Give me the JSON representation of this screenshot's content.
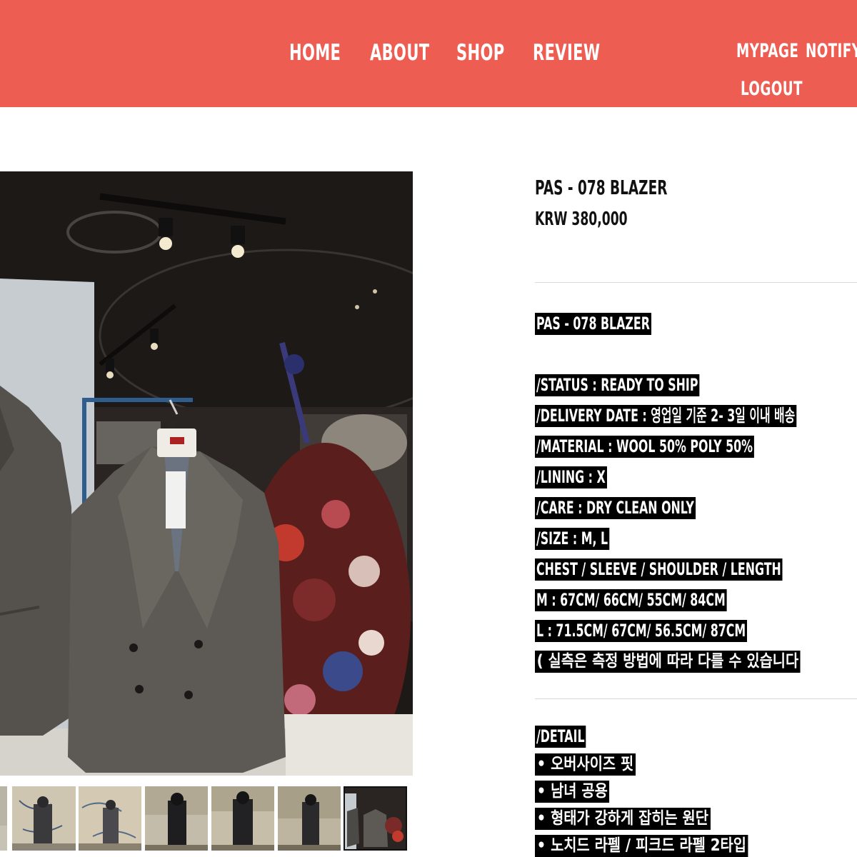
{
  "header": {
    "nav": [
      "HOME",
      "ABOUT",
      "SHOP",
      "REVIEW"
    ],
    "mypage": "MYPAGE",
    "notify": "NOTIFY",
    "logout": "LOGOUT"
  },
  "product": {
    "name": "PAS - 078 BLAZER",
    "price": "KRW 380,000"
  },
  "description": {
    "title": "PAS - 078 BLAZER",
    "specs": [
      "/STATUS : READY TO SHIP",
      "/DELIVERY DATE : 영업일 기준 2- 3일 이내 배송",
      "/MATERIAL : WOOL 50% POLY 50%",
      "/LINING : X",
      "/CARE : DRY CLEAN ONLY",
      "/SIZE : M, L",
      "CHEST / SLEEVE / SHOULDER / LENGTH",
      "M : 67CM/ 66CM/ 55CM/ 84CM",
      "L : 71.5CM/ 67CM/ 56.5CM/ 87CM",
      "( 실측은 측정 방법에 따라 다를 수 있습니다"
    ],
    "detail_title": "/DETAIL",
    "details": [
      "• 오버사이즈 핏",
      "• 남녀 공용",
      "• 형태가 강하게 잡히는 원단",
      "• 노치드 라펠 / 피크드 라펠 2타입"
    ]
  },
  "colors": {
    "header_bg": "#ed5d52",
    "text": "#111111",
    "highlight_bg": "#000000",
    "highlight_text": "#ffffff"
  }
}
